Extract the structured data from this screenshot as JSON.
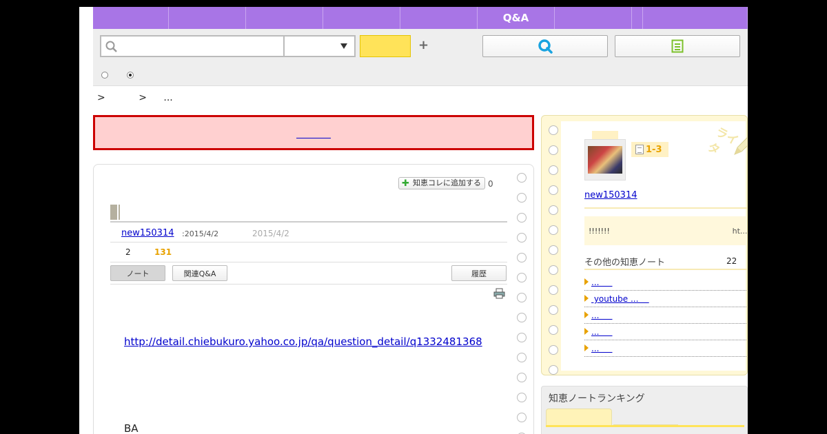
{
  "nav": {
    "tabs": [
      {
        "label": "",
        "width": 110
      },
      {
        "label": "",
        "width": 112
      },
      {
        "label": "",
        "width": 112
      },
      {
        "label": "",
        "width": 112
      },
      {
        "label": "",
        "width": 112
      },
      {
        "label": "Q&A",
        "width": 112
      },
      {
        "label": "",
        "width": 112
      },
      {
        "label": "",
        "width": 16
      },
      {
        "label": "",
        "width": 152
      }
    ]
  },
  "search": {
    "placeholder": "",
    "category": "",
    "search_label": "",
    "plus_label": "+"
  },
  "breadcrumb": [
    ">",
    ">",
    "..."
  ],
  "note": {
    "add_collection_label": "知恵コレに追加する",
    "collection_count": "0",
    "author": "new150314",
    "post_date": ":2015/4/2",
    "update_date": "2015/4/2",
    "stat_a": "2",
    "views": "131",
    "tabs": {
      "note": "ノート",
      "related": "関連Q&A",
      "history": "履歴"
    },
    "body_link": "http://detail.chiebukuro.yahoo.co.jp/qa/question_detail/q1332481368",
    "body_ba": "BA"
  },
  "sidebar": {
    "notes_range": "1-3",
    "author": "new150314",
    "quote_left": "!!!!!!!",
    "quote_right": "ht...[]",
    "other_notes_label": "その他の知恵ノート",
    "other_notes_count": "22",
    "items": [
      "...     ",
      " youtube ...    ",
      "...     ",
      "...     ",
      "...     "
    ],
    "more": "[]"
  },
  "ranking": {
    "title": "知恵ノートランキング"
  }
}
